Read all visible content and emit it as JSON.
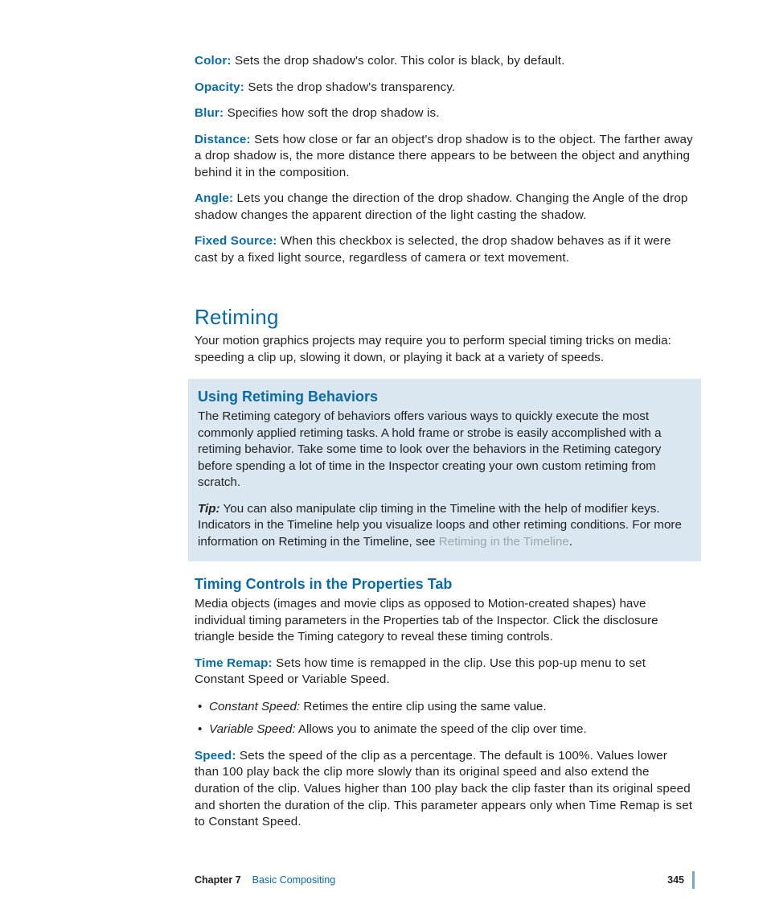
{
  "defs": [
    {
      "term": "Color:",
      "desc": "  Sets the drop shadow's color. This color is black, by default."
    },
    {
      "term": "Opacity:",
      "desc": "  Sets the drop shadow's transparency."
    },
    {
      "term": "Blur:",
      "desc": "  Specifies how soft the drop shadow is."
    },
    {
      "term": "Distance:",
      "desc": "  Sets how close or far an object's drop shadow is to the object. The farther away a drop shadow is, the more distance there appears to be between the object and anything behind it in the composition."
    },
    {
      "term": "Angle:",
      "desc": "  Lets you change the direction of the drop shadow. Changing the Angle of the drop shadow changes the apparent direction of the light casting the shadow."
    },
    {
      "term": "Fixed Source:",
      "desc": "  When this checkbox is selected, the drop shadow behaves as if it were cast by a fixed light source, regardless of camera or text movement."
    }
  ],
  "section_title": "Retiming",
  "section_para": "Your motion graphics projects may require you to perform special timing tricks on media: speeding a clip up, slowing it down, or playing it back at a variety of speeds.",
  "callout": {
    "title": "Using Retiming Behaviors",
    "body": "The Retiming category of behaviors offers various ways to quickly execute the most commonly applied retiming tasks. A hold frame or strobe is easily accomplished with a retiming behavior. Take some time to look over the behaviors in the Retiming category before spending a lot of time in the Inspector creating your own custom retiming from scratch.",
    "tip_label": "Tip:",
    "tip_body_pre": "  You can also manipulate clip timing in the Timeline with the help of modifier keys. Indicators in the Timeline help you visualize loops and other retiming conditions. For more information on Retiming in the Timeline, see ",
    "tip_link": "Retiming in the Timeline",
    "tip_body_post": "."
  },
  "subsection_title": "Timing Controls in the Properties Tab",
  "subsection_para": "Media objects (images and movie clips as opposed to Motion-created shapes) have individual timing parameters in the Properties tab of the Inspector. Click the disclosure triangle beside the Timing category to reveal these timing controls.",
  "params": [
    {
      "term": "Time Remap:",
      "desc": "  Sets how time is remapped in the clip. Use this pop-up menu to set Constant Speed or Variable Speed.",
      "bullets": [
        {
          "term": "Constant Speed:",
          "desc": "  Retimes the entire clip using the same value."
        },
        {
          "term": "Variable Speed:",
          "desc": "  Allows you to animate the speed of the clip over time."
        }
      ]
    },
    {
      "term": "Speed: ",
      "desc": "  Sets the speed of the clip as a percentage. The default is 100%. Values lower than 100 play back the clip more slowly than its original speed and also extend the duration of the clip. Values higher than 100 play back the clip faster than its original speed and shorten the duration of the clip. This parameter appears only when Time Remap is set to Constant Speed."
    }
  ],
  "footer": {
    "chapter_label": "Chapter 7",
    "chapter_title": "Basic Compositing",
    "page_num": "345"
  }
}
